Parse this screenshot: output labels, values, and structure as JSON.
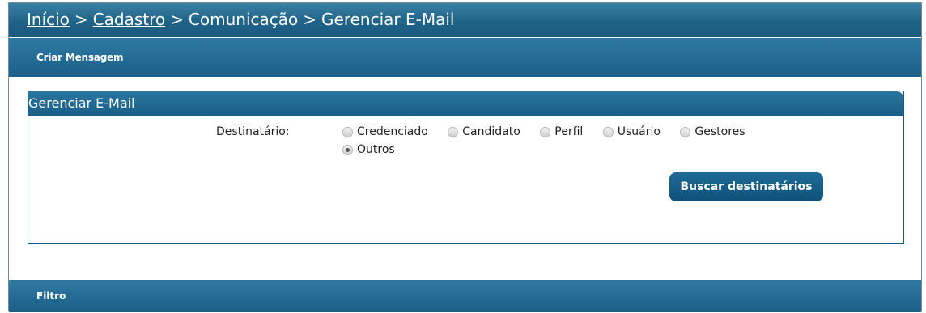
{
  "breadcrumb": {
    "home": "Início",
    "cadastro": "Cadastro",
    "comunicacao": "Comunicação",
    "current": "Gerenciar E-Mail",
    "separator": ">"
  },
  "subbar": {
    "label": "Criar Mensagem"
  },
  "panel": {
    "title": "Gerenciar E-Mail",
    "recipient_label": "Destinatário:",
    "options": [
      "Credenciado",
      "Candidato",
      "Perfil",
      "Usuário",
      "Gestores",
      "Outros"
    ],
    "selected": "Outros",
    "search_button": "Buscar destinatários"
  },
  "filter": {
    "label": "Filtro"
  },
  "colors": {
    "primary": "#1a5f88",
    "accent": "#2f7aa2"
  }
}
